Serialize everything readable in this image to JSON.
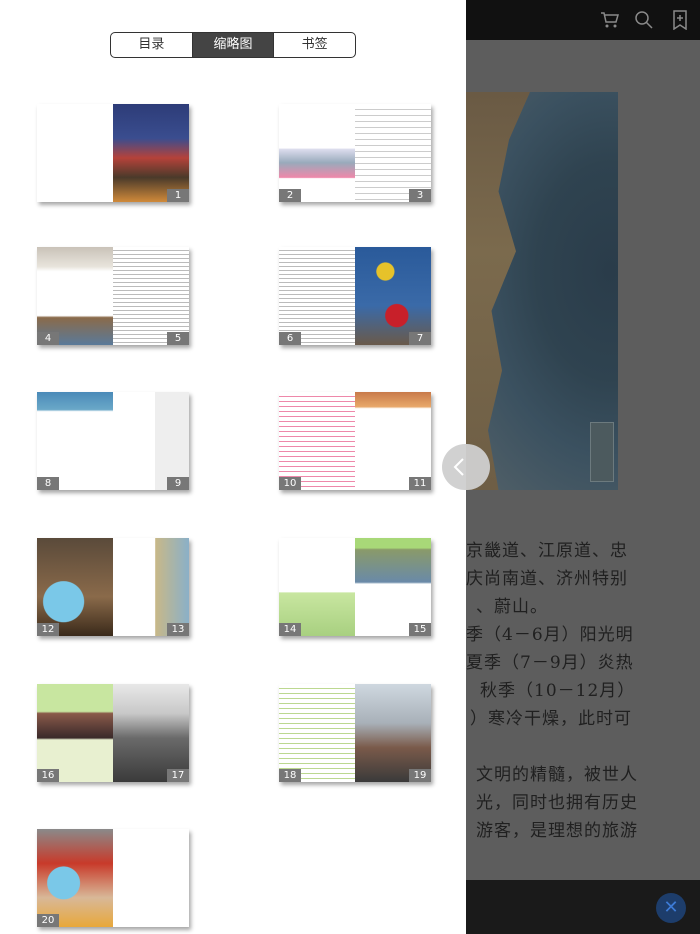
{
  "toolbar": {
    "icons": [
      "cart-icon",
      "search-icon",
      "bookmark-icon"
    ]
  },
  "tabs": [
    {
      "label": "目录",
      "active": false
    },
    {
      "label": "缩略图",
      "active": true
    },
    {
      "label": "书签",
      "active": false
    }
  ],
  "thumbnails": [
    {
      "left_label": "",
      "right_label": "1"
    },
    {
      "left_label": "2",
      "right_label": "3"
    },
    {
      "left_label": "4",
      "right_label": "5"
    },
    {
      "left_label": "6",
      "right_label": "7"
    },
    {
      "left_label": "8",
      "right_label": "9"
    },
    {
      "left_label": "10",
      "right_label": "11"
    },
    {
      "left_label": "12",
      "right_label": "13"
    },
    {
      "left_label": "14",
      "right_label": "15"
    },
    {
      "left_label": "16",
      "right_label": "17"
    },
    {
      "left_label": "18",
      "right_label": "19"
    },
    {
      "left_label": "20",
      "right_label": ""
    }
  ],
  "reader_text": [
    "京畿道、江原道、忠",
    "庆尚南道、济州特别",
    "、蔚山。",
    "季（4－6月）阳光明",
    "夏季（7－9月）炎热",
    "秋季（10－12月）",
    "）寒冷干燥，此时可",
    "文明的精髓，被世人",
    "光，同时也拥有历史",
    "游客，是理想的旅游"
  ],
  "colors": {
    "panel_bg": "#ffffff",
    "active_tab_bg": "#444444",
    "close_button": "#3d7bd6"
  }
}
